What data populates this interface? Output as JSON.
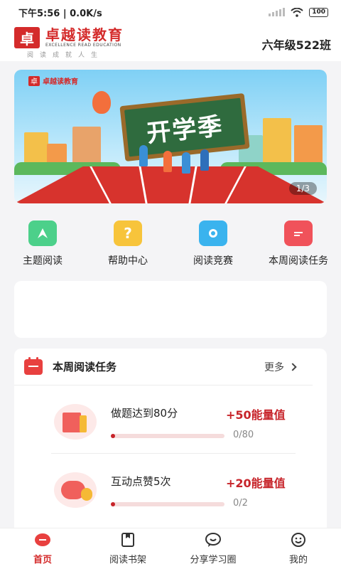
{
  "status_bar": {
    "time_speed": "下午5:56 | 0.0K/s",
    "battery": "100"
  },
  "header": {
    "brand_name": "卓越读教育",
    "brand_en": "EXCELLENCE READ EDUCATION",
    "slogan": "阅读成就人生",
    "logo_char": "卓",
    "class_name": "六年级522班"
  },
  "banner": {
    "logo_text": "卓越读教育",
    "headline": "开学季",
    "page_indicator": "1/3"
  },
  "quick_nav": [
    {
      "label": "主题阅读",
      "icon": "bookmark-icon",
      "color": "#4cd08a"
    },
    {
      "label": "帮助中心",
      "icon": "help-icon",
      "color": "#f7c43b"
    },
    {
      "label": "阅读竞赛",
      "icon": "camera-icon",
      "color": "#3ab3ee"
    },
    {
      "label": "本周阅读任务",
      "icon": "calendar-icon",
      "color": "#f0525a"
    }
  ],
  "weekly_tasks": {
    "title": "本周阅读任务",
    "more_label": "更多",
    "tasks": [
      {
        "name": "做题达到80分",
        "reward": "+50能量值",
        "progress": "0/80",
        "progress_fraction": 0.0
      },
      {
        "name": "互动点赞5次",
        "reward": "+20能量值",
        "progress": "0/2",
        "progress_fraction": 0.0
      }
    ]
  },
  "bottom_nav": [
    {
      "label": "首页",
      "active": true
    },
    {
      "label": "阅读书架",
      "active": false
    },
    {
      "label": "分享学习圈",
      "active": false
    },
    {
      "label": "我的",
      "active": false
    }
  ],
  "colors": {
    "brand": "#d42b2b",
    "accent": "#c7242a"
  }
}
